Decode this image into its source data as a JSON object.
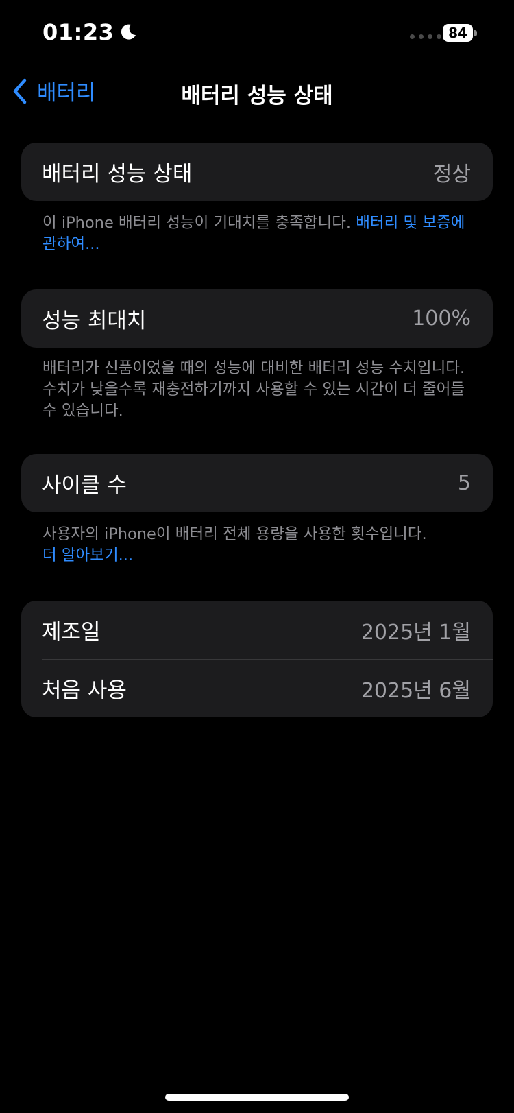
{
  "status_bar": {
    "time": "01:23",
    "battery_level": "84",
    "icons": [
      "moon-icon",
      "signal-dots-icon",
      "battery-icon"
    ]
  },
  "nav": {
    "back_label": "배터리",
    "title": "배터리 성능 상태"
  },
  "sections": {
    "health": {
      "label": "배터리 성능 상태",
      "value": "정상",
      "footnote_text": "이 iPhone 배터리 성능이 기대치를 충족합니다. ",
      "footnote_link": "배터리 및 보증에 관하여..."
    },
    "max_capacity": {
      "label": "성능 최대치",
      "value": "100%",
      "footnote_text": "배터리가 신품이었을 때의 성능에 대비한 배터리 성능 수치입니다. 수치가 낮을수록 재충전하기까지 사용할 수 있는 시간이 더 줄어들 수 있습니다."
    },
    "cycle_count": {
      "label": "사이클 수",
      "value": "5",
      "footnote_text": "사용자의 iPhone이 배터리 전체 용량을 사용한 횟수입니다.",
      "footnote_link": "더 알아보기..."
    },
    "dates": {
      "manufacture_label": "제조일",
      "manufacture_value": "2025년 1월",
      "first_use_label": "처음 사용",
      "first_use_value": "2025년 6월"
    }
  },
  "colors": {
    "background": "#000000",
    "card": "#1c1c1e",
    "accent": "#2f8cff",
    "secondary_text": "#8e8e93"
  }
}
